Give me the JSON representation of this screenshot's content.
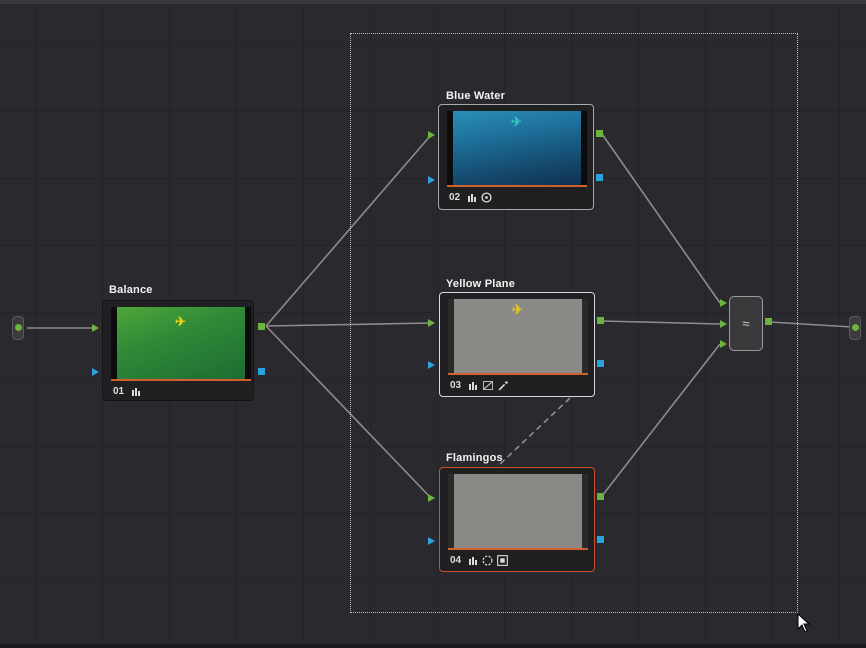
{
  "nodes": {
    "balance": {
      "title": "Balance",
      "number": "01",
      "tool_icons": [
        "primaries-icon"
      ]
    },
    "blue_water": {
      "title": "Blue Water",
      "number": "02",
      "tool_icons": [
        "primaries-icon",
        "window-circle-icon"
      ]
    },
    "yellow_plane": {
      "title": "Yellow Plane",
      "number": "03",
      "tool_icons": [
        "primaries-icon",
        "curves-icon",
        "qualifier-eyedropper-icon"
      ]
    },
    "flamingos": {
      "title": "Flamingos",
      "number": "04",
      "tool_icons": [
        "primaries-icon",
        "window-custom-icon",
        "key-icon"
      ]
    }
  },
  "mixer": {
    "icon": "layer-mixer-icon",
    "glyph": "≈"
  },
  "colors": {
    "input_port": "#6db33f",
    "key_port": "#2aa3dc",
    "active_node_border": "#c9502a",
    "connection": "#8a8a8a",
    "canvas_bg": "#2a292d"
  }
}
